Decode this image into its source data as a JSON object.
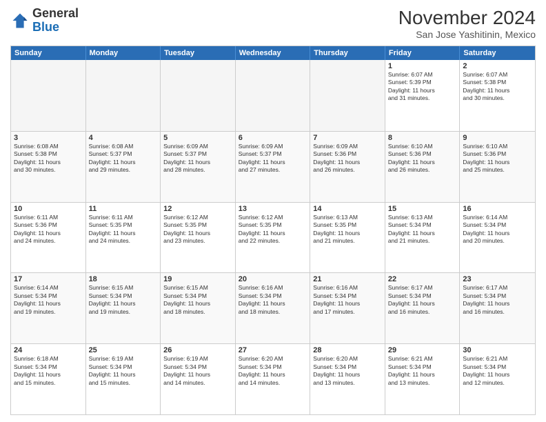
{
  "header": {
    "logo_general": "General",
    "logo_blue": "Blue",
    "title": "November 2024",
    "subtitle": "San Jose Yashitinin, Mexico"
  },
  "weekdays": [
    "Sunday",
    "Monday",
    "Tuesday",
    "Wednesday",
    "Thursday",
    "Friday",
    "Saturday"
  ],
  "weeks": [
    [
      {
        "day": "",
        "info": "",
        "empty": true
      },
      {
        "day": "",
        "info": "",
        "empty": true
      },
      {
        "day": "",
        "info": "",
        "empty": true
      },
      {
        "day": "",
        "info": "",
        "empty": true
      },
      {
        "day": "",
        "info": "",
        "empty": true
      },
      {
        "day": "1",
        "info": "Sunrise: 6:07 AM\nSunset: 5:39 PM\nDaylight: 11 hours\nand 31 minutes."
      },
      {
        "day": "2",
        "info": "Sunrise: 6:07 AM\nSunset: 5:38 PM\nDaylight: 11 hours\nand 30 minutes."
      }
    ],
    [
      {
        "day": "3",
        "info": "Sunrise: 6:08 AM\nSunset: 5:38 PM\nDaylight: 11 hours\nand 30 minutes."
      },
      {
        "day": "4",
        "info": "Sunrise: 6:08 AM\nSunset: 5:37 PM\nDaylight: 11 hours\nand 29 minutes."
      },
      {
        "day": "5",
        "info": "Sunrise: 6:09 AM\nSunset: 5:37 PM\nDaylight: 11 hours\nand 28 minutes."
      },
      {
        "day": "6",
        "info": "Sunrise: 6:09 AM\nSunset: 5:37 PM\nDaylight: 11 hours\nand 27 minutes."
      },
      {
        "day": "7",
        "info": "Sunrise: 6:09 AM\nSunset: 5:36 PM\nDaylight: 11 hours\nand 26 minutes."
      },
      {
        "day": "8",
        "info": "Sunrise: 6:10 AM\nSunset: 5:36 PM\nDaylight: 11 hours\nand 26 minutes."
      },
      {
        "day": "9",
        "info": "Sunrise: 6:10 AM\nSunset: 5:36 PM\nDaylight: 11 hours\nand 25 minutes."
      }
    ],
    [
      {
        "day": "10",
        "info": "Sunrise: 6:11 AM\nSunset: 5:36 PM\nDaylight: 11 hours\nand 24 minutes."
      },
      {
        "day": "11",
        "info": "Sunrise: 6:11 AM\nSunset: 5:35 PM\nDaylight: 11 hours\nand 24 minutes."
      },
      {
        "day": "12",
        "info": "Sunrise: 6:12 AM\nSunset: 5:35 PM\nDaylight: 11 hours\nand 23 minutes."
      },
      {
        "day": "13",
        "info": "Sunrise: 6:12 AM\nSunset: 5:35 PM\nDaylight: 11 hours\nand 22 minutes."
      },
      {
        "day": "14",
        "info": "Sunrise: 6:13 AM\nSunset: 5:35 PM\nDaylight: 11 hours\nand 21 minutes."
      },
      {
        "day": "15",
        "info": "Sunrise: 6:13 AM\nSunset: 5:34 PM\nDaylight: 11 hours\nand 21 minutes."
      },
      {
        "day": "16",
        "info": "Sunrise: 6:14 AM\nSunset: 5:34 PM\nDaylight: 11 hours\nand 20 minutes."
      }
    ],
    [
      {
        "day": "17",
        "info": "Sunrise: 6:14 AM\nSunset: 5:34 PM\nDaylight: 11 hours\nand 19 minutes."
      },
      {
        "day": "18",
        "info": "Sunrise: 6:15 AM\nSunset: 5:34 PM\nDaylight: 11 hours\nand 19 minutes."
      },
      {
        "day": "19",
        "info": "Sunrise: 6:15 AM\nSunset: 5:34 PM\nDaylight: 11 hours\nand 18 minutes."
      },
      {
        "day": "20",
        "info": "Sunrise: 6:16 AM\nSunset: 5:34 PM\nDaylight: 11 hours\nand 18 minutes."
      },
      {
        "day": "21",
        "info": "Sunrise: 6:16 AM\nSunset: 5:34 PM\nDaylight: 11 hours\nand 17 minutes."
      },
      {
        "day": "22",
        "info": "Sunrise: 6:17 AM\nSunset: 5:34 PM\nDaylight: 11 hours\nand 16 minutes."
      },
      {
        "day": "23",
        "info": "Sunrise: 6:17 AM\nSunset: 5:34 PM\nDaylight: 11 hours\nand 16 minutes."
      }
    ],
    [
      {
        "day": "24",
        "info": "Sunrise: 6:18 AM\nSunset: 5:34 PM\nDaylight: 11 hours\nand 15 minutes."
      },
      {
        "day": "25",
        "info": "Sunrise: 6:19 AM\nSunset: 5:34 PM\nDaylight: 11 hours\nand 15 minutes."
      },
      {
        "day": "26",
        "info": "Sunrise: 6:19 AM\nSunset: 5:34 PM\nDaylight: 11 hours\nand 14 minutes."
      },
      {
        "day": "27",
        "info": "Sunrise: 6:20 AM\nSunset: 5:34 PM\nDaylight: 11 hours\nand 14 minutes."
      },
      {
        "day": "28",
        "info": "Sunrise: 6:20 AM\nSunset: 5:34 PM\nDaylight: 11 hours\nand 13 minutes."
      },
      {
        "day": "29",
        "info": "Sunrise: 6:21 AM\nSunset: 5:34 PM\nDaylight: 11 hours\nand 13 minutes."
      },
      {
        "day": "30",
        "info": "Sunrise: 6:21 AM\nSunset: 5:34 PM\nDaylight: 11 hours\nand 12 minutes."
      }
    ]
  ]
}
